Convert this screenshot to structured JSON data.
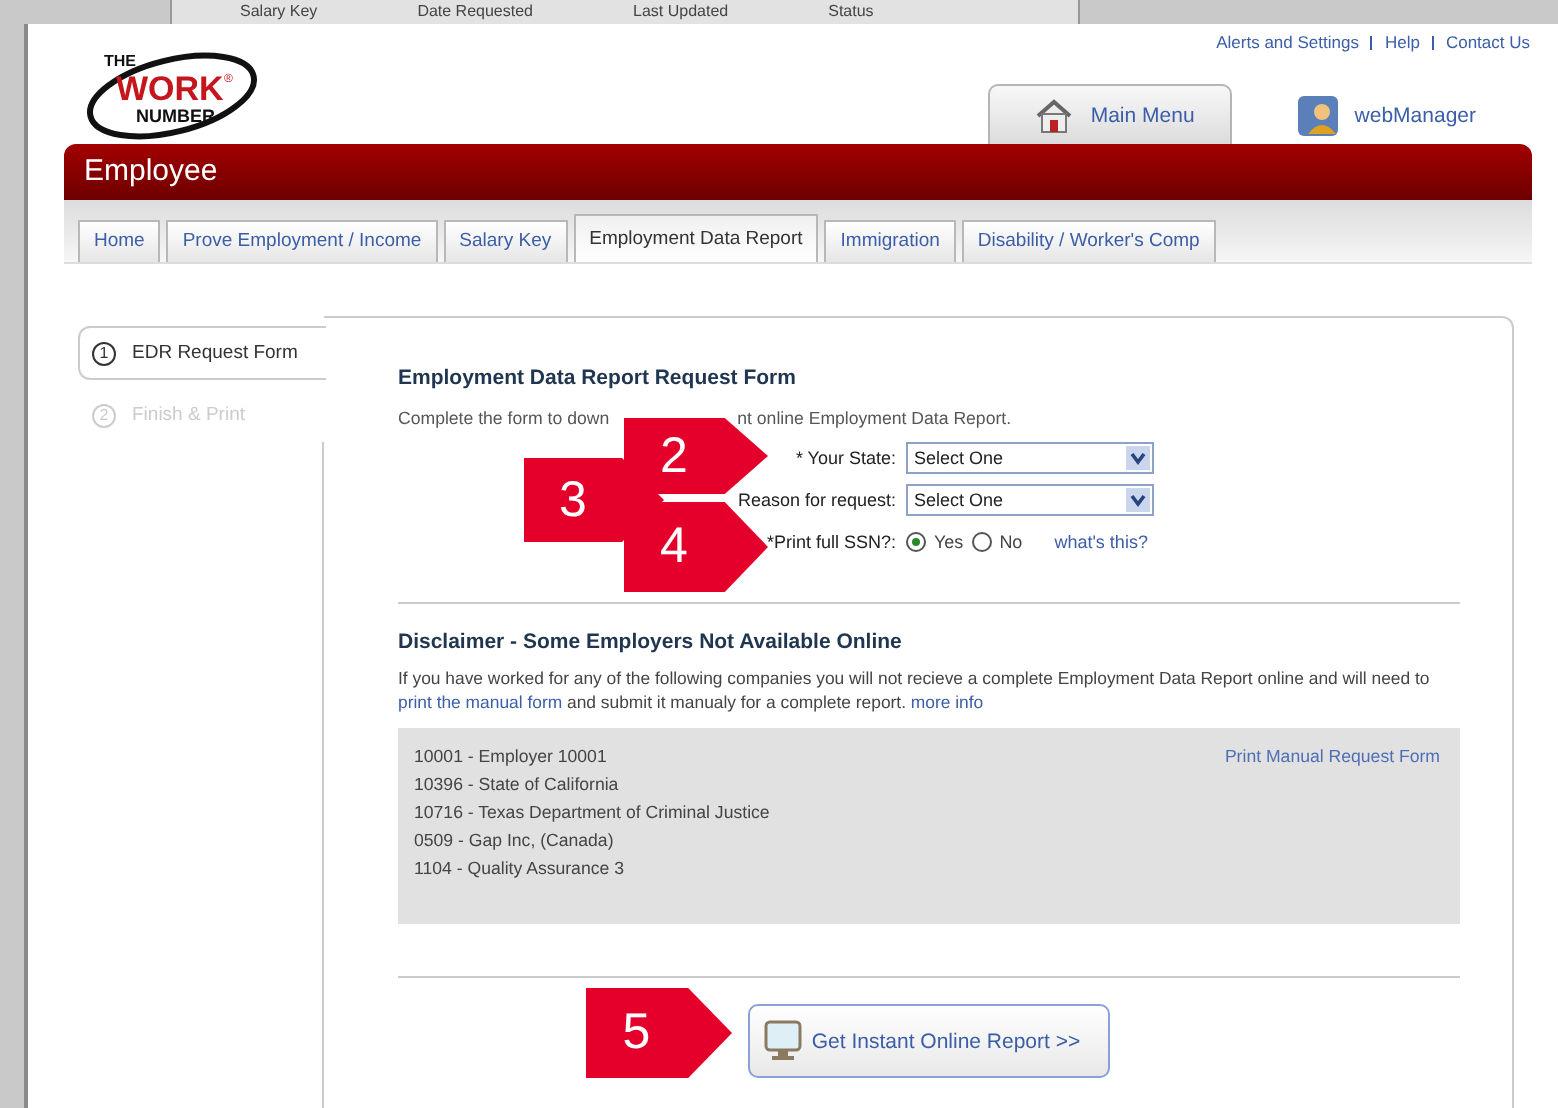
{
  "background_window": {
    "columns": [
      "Salary Key",
      "Date Requested",
      "Last Updated",
      "Status"
    ]
  },
  "header": {
    "links": [
      "Alerts and Settings",
      "Help",
      "Contact Us"
    ],
    "logo": {
      "line_1": "THE",
      "line_2": "WORK",
      "trademark": "®",
      "line_3": "NUMBER"
    },
    "nav_tabs": [
      {
        "kind": "house",
        "label": "Main Menu",
        "selected": true
      },
      {
        "kind": "person",
        "label": "webManager",
        "selected": false
      }
    ]
  },
  "section_bar": {
    "title": "Employee"
  },
  "tabs": [
    {
      "label": "Home",
      "selected": false
    },
    {
      "label": "Prove Employment / Income",
      "selected": false
    },
    {
      "label": "Salary Key",
      "selected": false
    },
    {
      "label": "Employment Data Report",
      "selected": true
    },
    {
      "label": "Immigration",
      "selected": false
    },
    {
      "label": "Disability / Worker's Comp",
      "selected": false
    }
  ],
  "steps": [
    {
      "number": "1",
      "label": "EDR Request Form",
      "selected": true
    },
    {
      "number": "2",
      "label": "Finish & Print",
      "selected": false
    }
  ],
  "form": {
    "title": "Employment Data Report Request Form",
    "intro_before": "Complete the form to down",
    "intro_after": "nt online Employment Data Report.",
    "fields": [
      {
        "kind": "select",
        "label": "* Your State:",
        "value": "Select One"
      },
      {
        "kind": "select",
        "label": "Reason for request:",
        "value": "Select One"
      },
      {
        "kind": "radio",
        "label": "*Print full SSN?:",
        "options": [
          {
            "label": "Yes",
            "selected": true
          },
          {
            "label": "No",
            "selected": false
          }
        ],
        "help_link": "what's this?"
      }
    ]
  },
  "disclaimer": {
    "title": "Disclaimer - Some Employers Not Available Online",
    "text_parts": [
      {
        "kind": "text",
        "text": "If you have worked for any of the following companies you will not recieve a complete Employment Data Report online and will need to "
      },
      {
        "kind": "link",
        "text": "print the manual form"
      },
      {
        "kind": "text",
        "text": " and submit it manualy for a complete report. "
      },
      {
        "kind": "link",
        "text": "more info"
      }
    ],
    "companies": [
      "10001 - Employer 10001",
      "10396 - State of California",
      "10716 - Texas Department of Criminal Justice",
      "0509 - Gap Inc, (Canada)",
      "1104 - Quality Assurance 3"
    ],
    "print_link": "Print Manual Request Form"
  },
  "submit_button": {
    "label": "Get Instant Online Report >>"
  },
  "callouts": [
    {
      "number": "2"
    },
    {
      "number": "3"
    },
    {
      "number": "4"
    },
    {
      "number": "5"
    }
  ]
}
